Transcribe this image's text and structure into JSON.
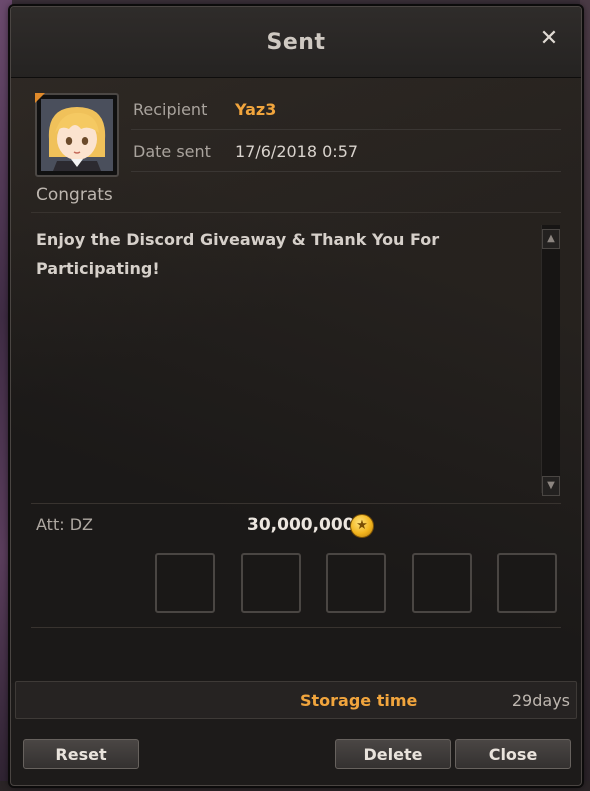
{
  "window": {
    "title": "Sent",
    "close_icon": "close-icon"
  },
  "mail": {
    "recipient_label": "Recipient",
    "recipient_name": "Yaz3",
    "date_label": "Date sent",
    "date_value": "17/6/2018 0:57",
    "subject": "Congrats",
    "body": "Enjoy the Discord Giveaway & Thank You For Participating!"
  },
  "attachment": {
    "label": "Att: DZ",
    "amount": "30,000,000",
    "currency_icon": "gold-coin-icon",
    "slots": 5
  },
  "footer": {
    "storage_label": "Storage time",
    "storage_days": "29days"
  },
  "buttons": {
    "reset": "Reset",
    "delete": "Delete",
    "close": "Close"
  },
  "colors": {
    "accent": "#f1a53d",
    "text": "#d6d0ca",
    "panel": "#1b1918"
  }
}
